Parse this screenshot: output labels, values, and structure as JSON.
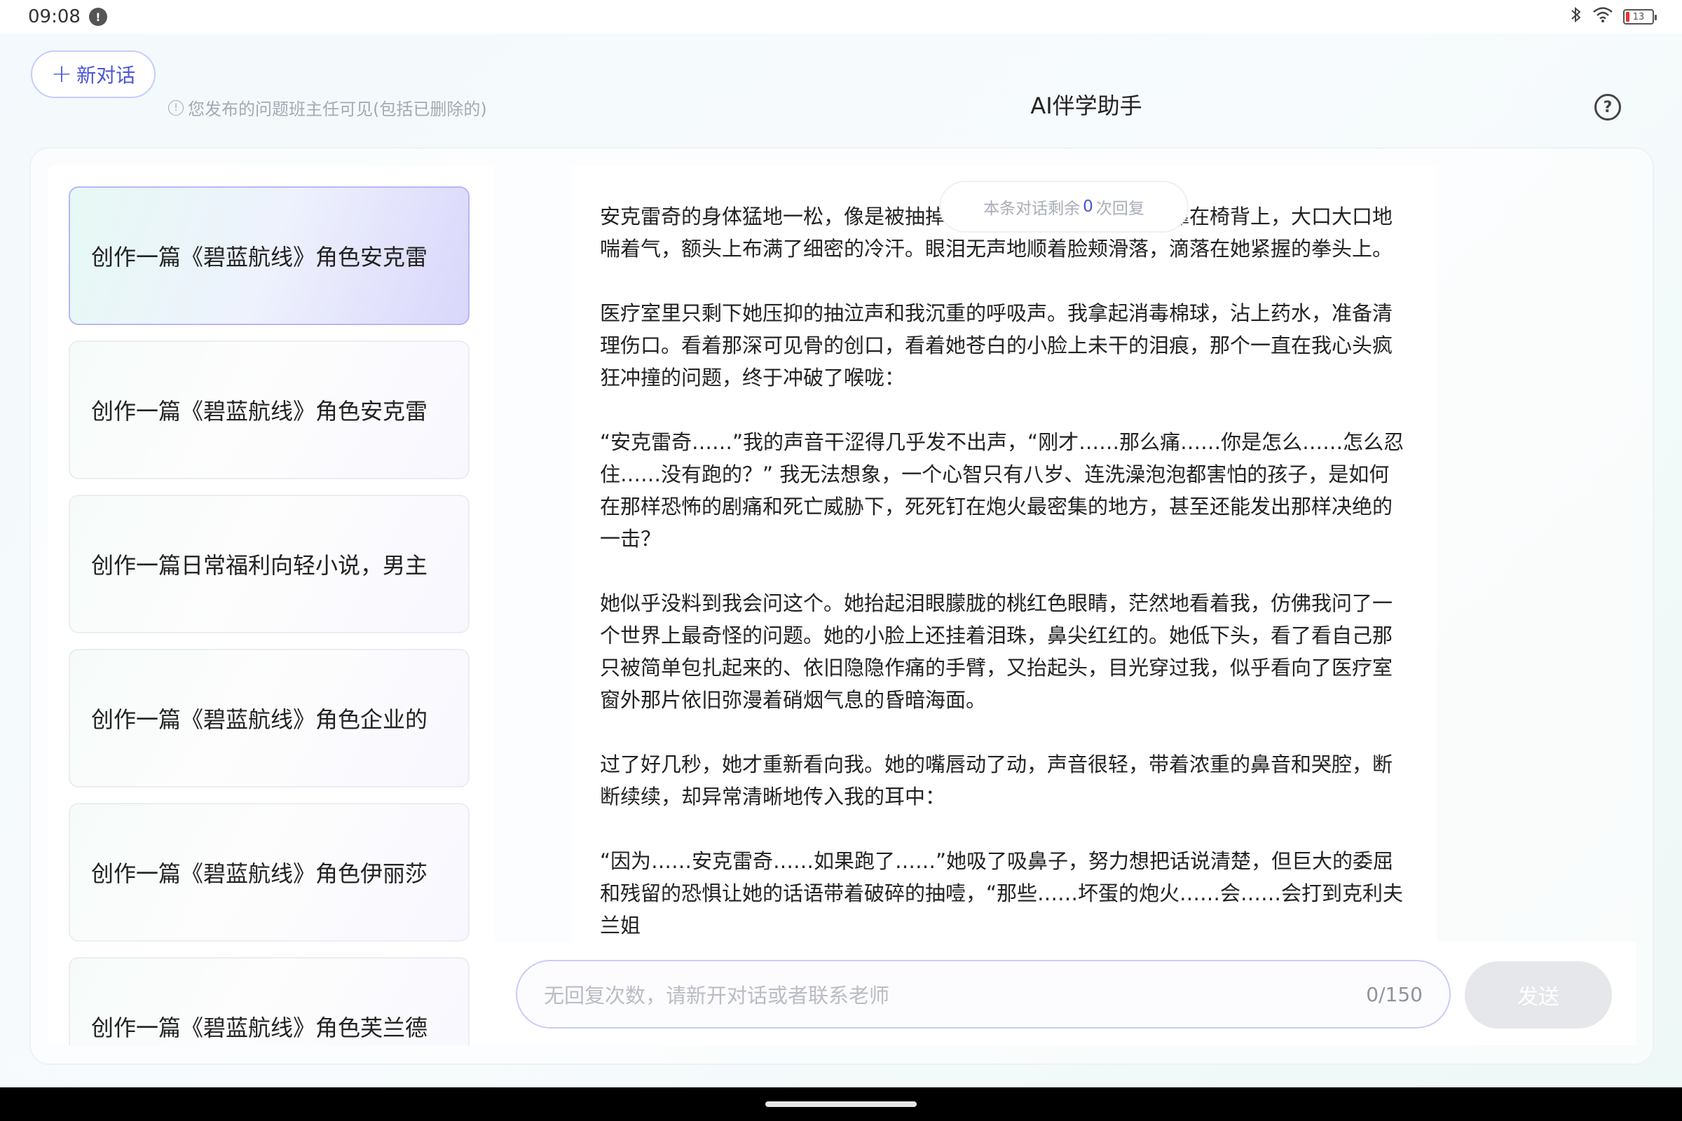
{
  "status_bar": {
    "time": "09:08",
    "notification_badge": "!",
    "battery_level": "13"
  },
  "header": {
    "new_chat_label": "新对话",
    "notice": "您发布的问题班主任可见(包括已删除的)",
    "title": "AI伴学助手"
  },
  "sidebar": {
    "items": [
      {
        "label": "创作一篇《碧蓝航线》角色安克雷",
        "active": true
      },
      {
        "label": "创作一篇《碧蓝航线》角色安克雷",
        "active": false
      },
      {
        "label": "创作一篇日常福利向轻小说，男主",
        "active": false
      },
      {
        "label": "创作一篇《碧蓝航线》角色企业的",
        "active": false
      },
      {
        "label": "创作一篇《碧蓝航线》角色伊丽莎",
        "active": false
      },
      {
        "label": "创作一篇《碧蓝航线》角色芙兰德",
        "active": false
      }
    ]
  },
  "chat": {
    "remaining_prefix": "本条对话剩余",
    "remaining_count": "0",
    "remaining_suffix": "次回复",
    "paragraphs": [
      "安克雷奇的身体猛地一松，像是被抽掉了所有力气一样，软软地靠在椅背上，大口大口地喘着气，额头上布满了细密的冷汗。眼泪无声地顺着脸颊滑落，滴落在她紧握的拳头上。",
      "医疗室里只剩下她压抑的抽泣声和我沉重的呼吸声。我拿起消毒棉球，沾上药水，准备清理伤口。看着那深可见骨的创口，看着她苍白的小脸上未干的泪痕，那个一直在我心头疯狂冲撞的问题，终于冲破了喉咙：",
      "“安克雷奇……”我的声音干涩得几乎发不出声，“刚才……那么痛……你是怎么……怎么忍住……没有跑的？” 我无法想象，一个心智只有八岁、连洗澡泡泡都害怕的孩子，是如何在那样恐怖的剧痛和死亡威胁下，死死钉在炮火最密集的地方，甚至还能发出那样决绝的一击？",
      "她似乎没料到我会问这个。她抬起泪眼朦胧的桃红色眼睛，茫然地看着我，仿佛我问了一个世界上最奇怪的问题。她的小脸上还挂着泪珠，鼻尖红红的。她低下头，看了看自己那只被简单包扎起来的、依旧隐隐作痛的手臂，又抬起头，目光穿过我，似乎看向了医疗室窗外那片依旧弥漫着硝烟气息的昏暗海面。",
      "过了好几秒，她才重新看向我。她的嘴唇动了动，声音很轻，带着浓重的鼻音和哭腔，断断续续，却异常清晰地传入我的耳中：",
      "“因为……安克雷奇……如果跑了……”她吸了吸鼻子，努力想把话说清楚，但巨大的委屈和残留的恐惧让她的话语带着破碎的抽噎，“那些……坏蛋的炮火……会……会打到克利夫兰姐"
    ]
  },
  "input": {
    "placeholder": "无回复次数，请新开对话或者联系老师",
    "counter": "0/150",
    "send_label": "发送"
  }
}
